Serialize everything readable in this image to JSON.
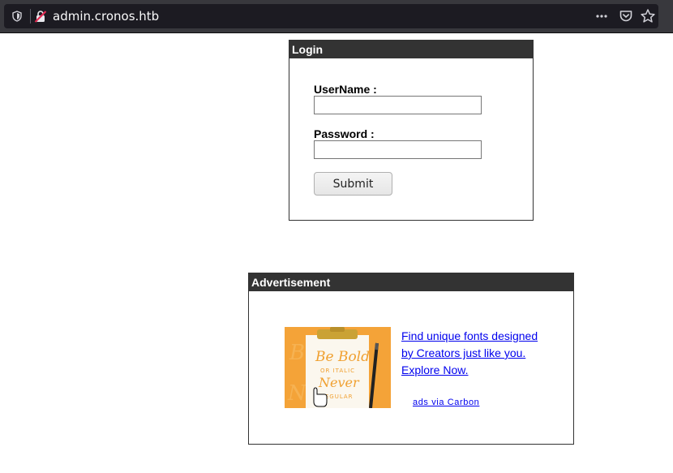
{
  "browser": {
    "url": "admin.cronos.htb",
    "icons": [
      "shield-icon",
      "insecure-lock-icon",
      "more-options-icon",
      "pocket-icon",
      "bookmark-star-icon"
    ]
  },
  "login": {
    "title": "Login",
    "username_label": "UserName :",
    "username_value": "",
    "password_label": "Password :",
    "password_value": "",
    "submit_label": "Submit"
  },
  "advertisement": {
    "title": "Advertisement",
    "image_lettering": [
      "Be Bold",
      "OR ITALIC",
      "Never",
      "REGULAR"
    ],
    "ad_text": "Find unique fonts designed by Creators just like you. Explore Now.",
    "via_text": "ads via Carbon"
  },
  "colors": {
    "chrome_bg": "#38383d",
    "urlbar_bg": "#1c1b22",
    "panel_header_bg": "#333333",
    "link": "#0000ee",
    "ad_image_bg": "#f4a338"
  }
}
